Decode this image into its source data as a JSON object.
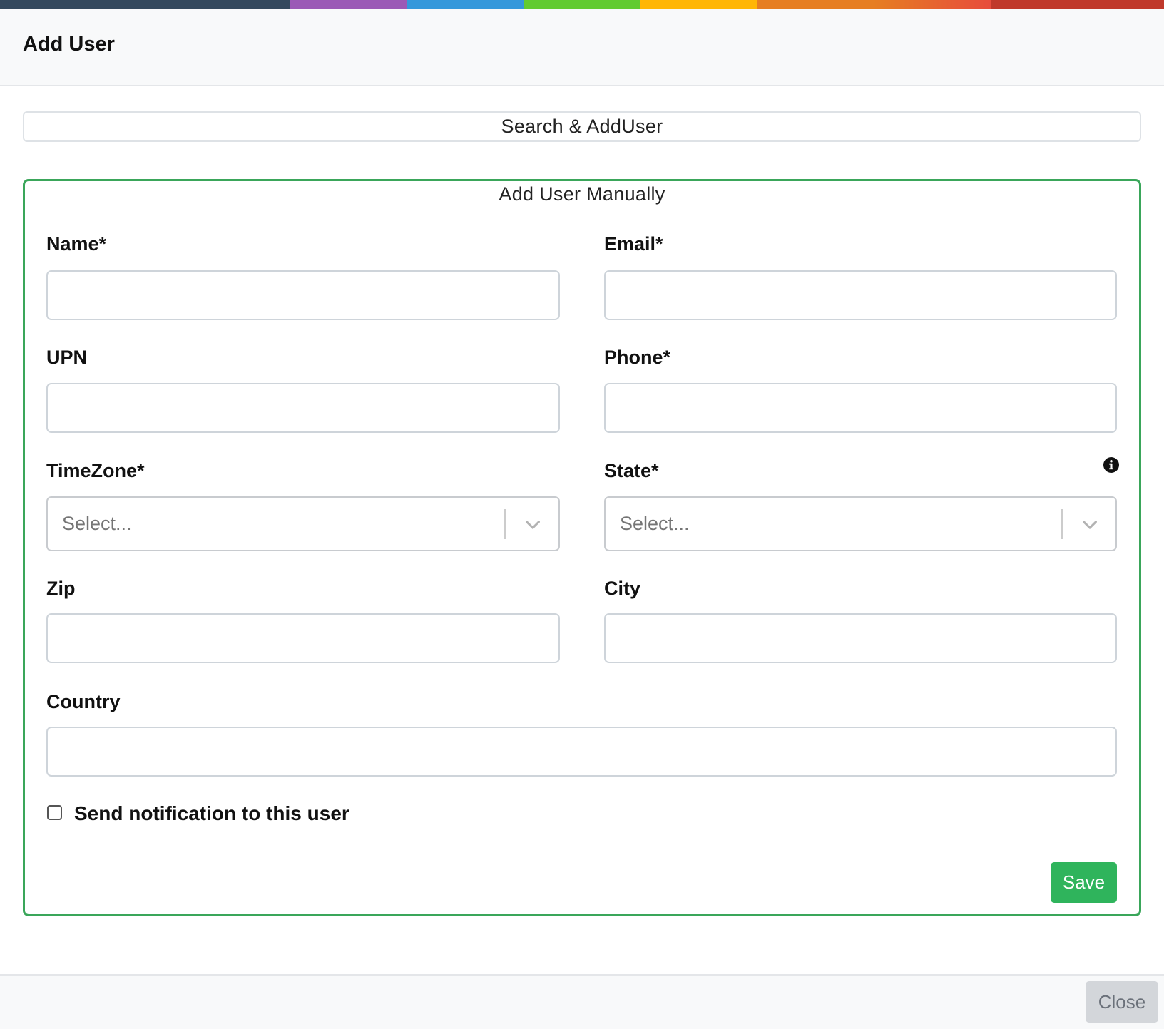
{
  "header": {
    "title": "Add User"
  },
  "colors": {
    "bar": [
      "#34495e",
      "#9b59b6",
      "#3498db",
      "#62cb31",
      "#ffb606",
      "#e67e22",
      "#e74c3c",
      "#c0392b"
    ],
    "accent_green": "#3aa65a",
    "save_green": "#2fb45c"
  },
  "search_add": {
    "label": "Search & AddUser"
  },
  "manual": {
    "legend": "Add User Manually",
    "fields": {
      "name": {
        "label": "Name*",
        "value": ""
      },
      "email": {
        "label": "Email*",
        "value": ""
      },
      "upn": {
        "label": "UPN",
        "value": ""
      },
      "phone": {
        "label": "Phone*",
        "value": ""
      },
      "timezone": {
        "label": "TimeZone*",
        "placeholder": "Select..."
      },
      "state": {
        "label": "State*",
        "placeholder": "Select...",
        "info_icon": "info-circle-icon"
      },
      "zip": {
        "label": "Zip",
        "value": ""
      },
      "city": {
        "label": "City",
        "value": ""
      },
      "country": {
        "label": "Country",
        "value": ""
      }
    },
    "notify": {
      "label": "Send notification to this user",
      "checked": false
    },
    "save_label": "Save"
  },
  "footer": {
    "close_label": "Close"
  }
}
